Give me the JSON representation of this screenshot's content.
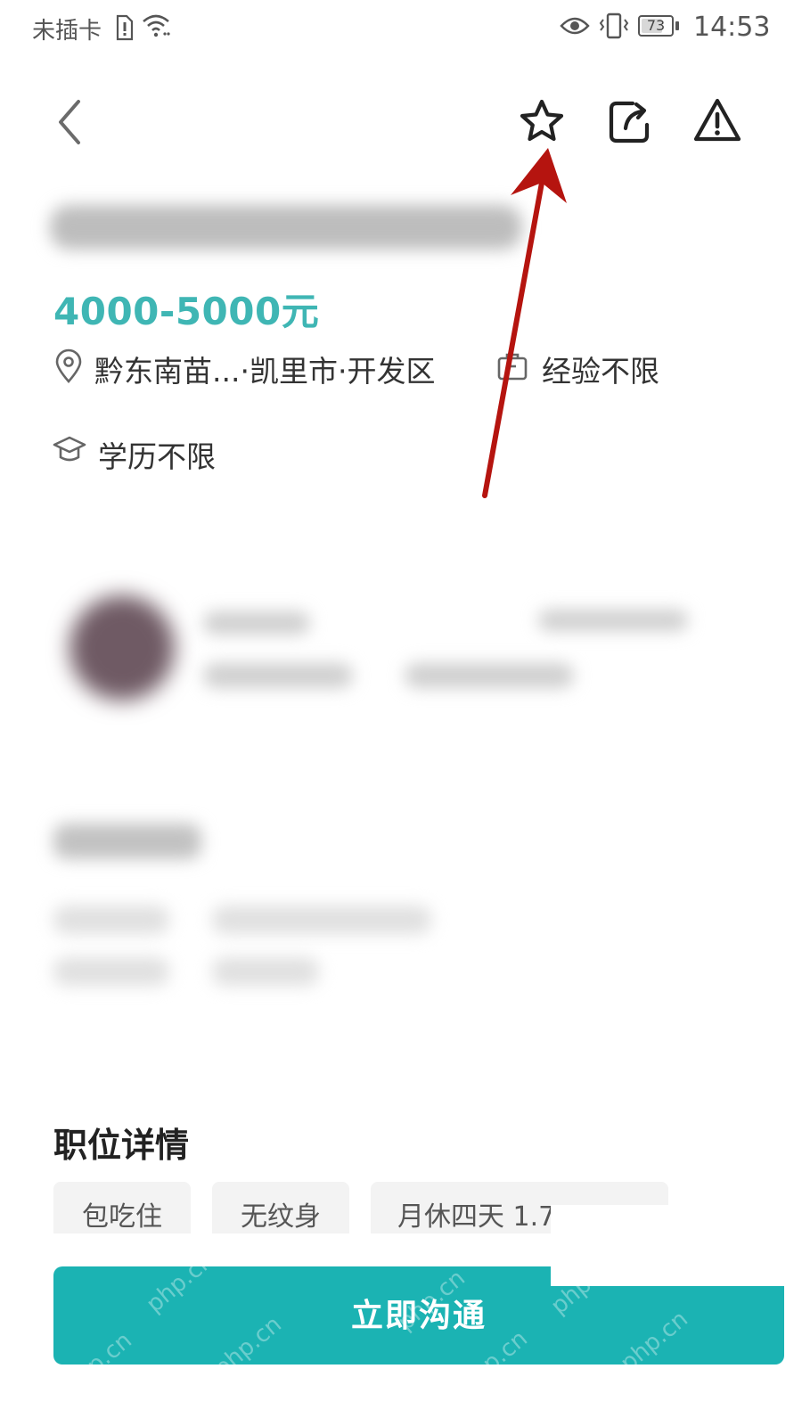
{
  "status_bar": {
    "carrier": "未插卡",
    "battery": "73",
    "battery_level": 0.73,
    "time": "14:53",
    "icons": [
      "sim-alert-icon",
      "wifi-icon",
      "eye-icon",
      "vibrate-icon",
      "battery-icon"
    ]
  },
  "toolbar": {
    "icons": [
      "back-icon",
      "star-icon",
      "share-icon",
      "report-icon"
    ]
  },
  "job": {
    "salary": "4000-5000元",
    "location": "黔东南苗...·凯里市·开发区",
    "experience": "经验不限",
    "education": "学历不限"
  },
  "details": {
    "title": "职位详情",
    "tags": [
      "包吃住",
      "无纹身",
      "月休四天 1.7"
    ]
  },
  "action": {
    "chat_label": "立即沟通"
  },
  "watermark": {
    "text": "php.cn"
  },
  "colors": {
    "accent": "#3fb6b4",
    "button": "#1bb3b3",
    "annotation": "#b5140f"
  }
}
